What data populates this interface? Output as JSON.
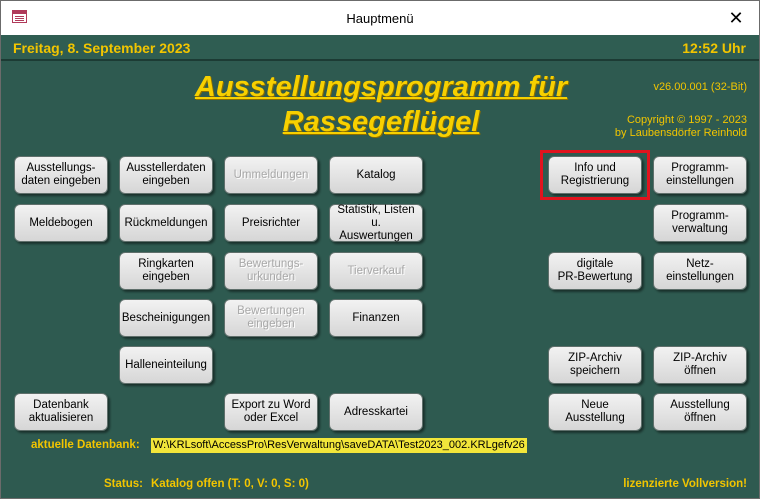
{
  "window": {
    "title": "Hauptmenü",
    "close_glyph": "✕"
  },
  "header": {
    "date": "Freitag, 8. September 2023",
    "time": "12:52 Uhr"
  },
  "app": {
    "title_line1": "Ausstellungsprogramm für",
    "title_line2": "Rassegeflügel",
    "version": "v26.00.001 (32-Bit)",
    "copyright_line1": "Copyright ©  1997 - 2023",
    "copyright_line2": "by Laubensdörfer Reinhold"
  },
  "buttons": {
    "ausstellungsdaten": "Ausstellungs-\ndaten eingeben",
    "ausstellerdaten": "Ausstellerdaten\neingeben",
    "ummeldungen": "Ummeldungen",
    "katalog": "Katalog",
    "info": "Info und\nRegistrierung",
    "programmeinstellungen": "Programm-\neinstellungen",
    "meldebogen": "Meldebogen",
    "rueckmeldungen": "Rückmeldungen",
    "preisrichter": "Preisrichter",
    "statistik": "Statistik, Listen u.\nAuswertungen",
    "programmverwaltung": "Programm-\nverwaltung",
    "ringkarten": "Ringkarten\neingeben",
    "bewertungsurkunden": "Bewertungs-\nurkunden",
    "tierverkauf": "Tierverkauf",
    "pr_bewertung": "digitale\nPR-Bewertung",
    "netzeinstellungen": "Netz-\neinstellungen",
    "bescheinigungen": "Bescheinigungen",
    "bewertungen": "Bewertungen\neingeben",
    "finanzen": "Finanzen",
    "halleneinteilung": "Halleneinteilung",
    "zip_speichern": "ZIP-Archiv\nspeichern",
    "zip_oeffnen": "ZIP-Archiv\nöffnen",
    "datenbank": "Datenbank\naktualisieren",
    "export": "Export zu Word\noder Excel",
    "adresskartei": "Adresskartei",
    "neue_ausstellung": "Neue\nAusstellung",
    "ausstellung_oeffnen": "Ausstellung\nöffnen"
  },
  "database": {
    "label": "aktuelle Datenbank:",
    "path": "W:\\KRLsoft\\AccessPro\\ResVerwaltung\\saveDATA\\Test2023_002.KRLgefv26"
  },
  "status": {
    "label": "Status:",
    "value": "Katalog offen (T: 0, V: 0, S: 0)",
    "license": "lizenzierte Vollversion!"
  },
  "colors": {
    "background": "#2e5a50",
    "accent": "#f2c500",
    "highlight": "#e0141e",
    "path_bg": "#f2e63a"
  },
  "icons": {
    "app": "access-form-icon",
    "close": "close-icon"
  }
}
